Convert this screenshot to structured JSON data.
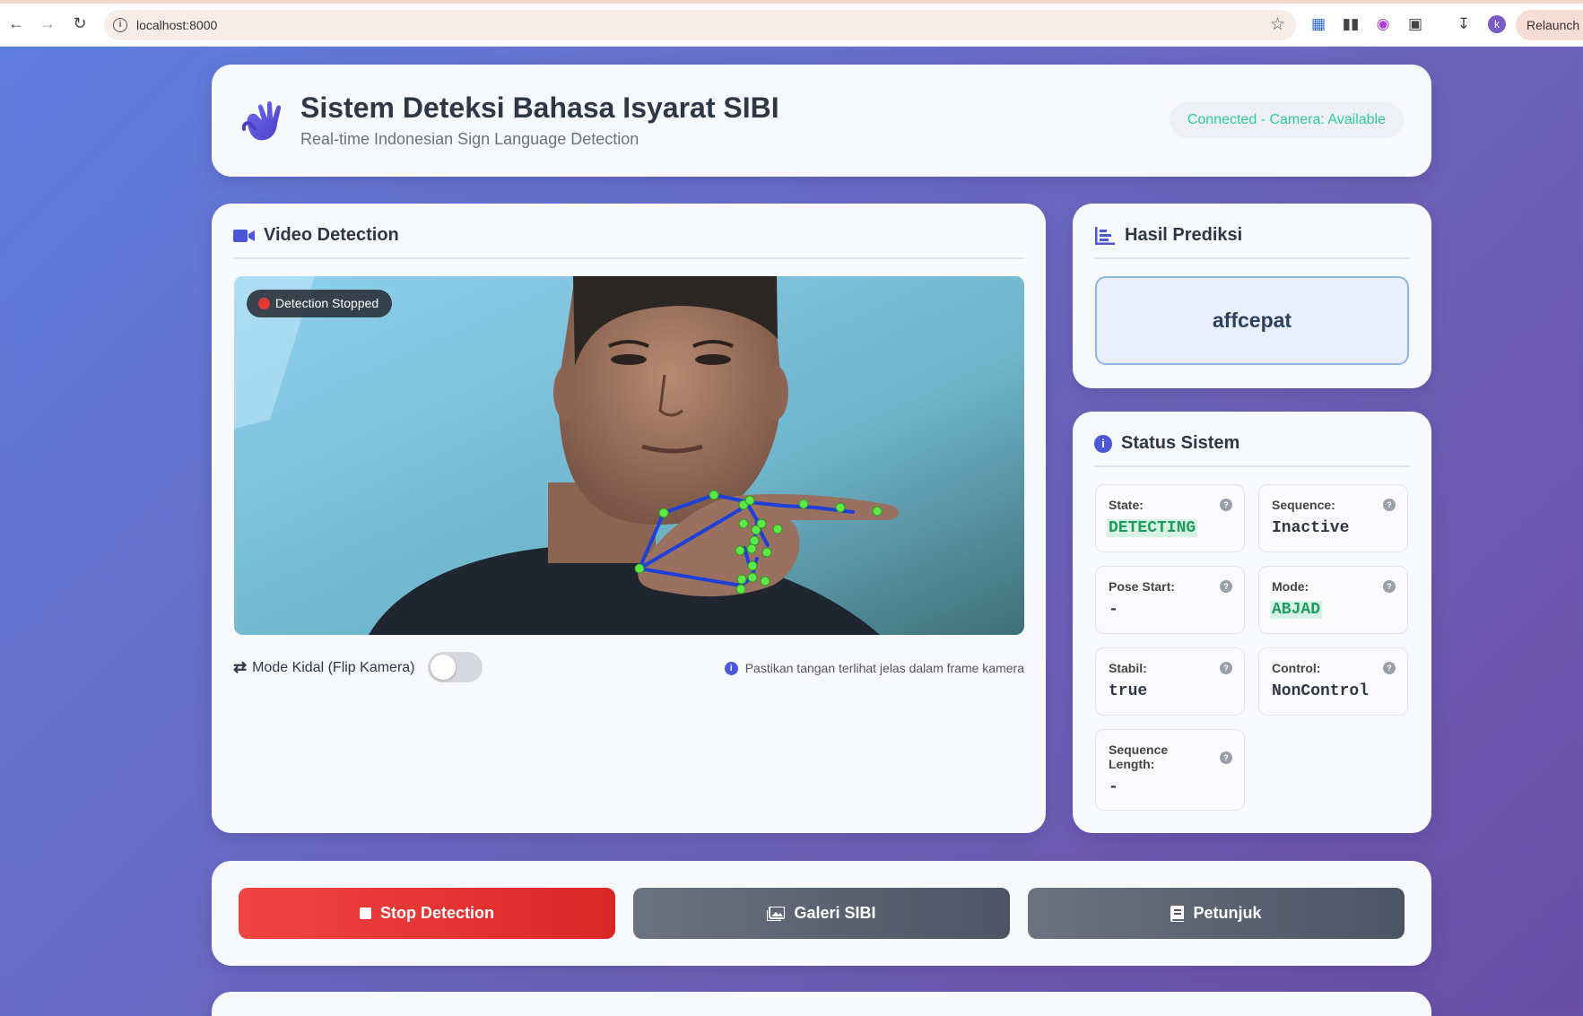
{
  "browser": {
    "url": "localhost:8000",
    "relaunch_label": "Relaunch to update",
    "profile_initial": "k"
  },
  "header": {
    "title": "Sistem Deteksi Bahasa Isyarat SIBI",
    "subtitle": "Real-time Indonesian Sign Language Detection",
    "connection_status": "Connected - Camera: Available"
  },
  "video": {
    "section_title": "Video Detection",
    "detection_badge": "Detection Stopped",
    "mode_kidal_label": "Mode Kidal (Flip Kamera)",
    "mode_kidal_on": false,
    "hint": "Pastikan tangan terlihat jelas dalam frame kamera"
  },
  "prediction": {
    "section_title": "Hasil Prediksi",
    "value": "affcepat"
  },
  "status": {
    "section_title": "Status Sistem",
    "items": [
      {
        "label": "State:",
        "value": "DETECTING"
      },
      {
        "label": "Sequence:",
        "value": "Inactive"
      },
      {
        "label": "Pose Start:",
        "value": "-"
      },
      {
        "label": "Mode:",
        "value": "ABJAD"
      },
      {
        "label": "Stabil:",
        "value": "true"
      },
      {
        "label": "Control:",
        "value": "NonControl"
      },
      {
        "label": "Sequence Length:",
        "value": "-"
      }
    ]
  },
  "controls": {
    "stop_label": "Stop Detection",
    "gallery_label": "Galeri SIBI",
    "guide_label": "Petunjuk"
  },
  "colors": {
    "accent": "#4c56d9",
    "stop_button": "#ef4444",
    "connected_text": "#2ecc9a",
    "landmark_point": "#5ee84a",
    "landmark_line": "#1f3fd6"
  }
}
